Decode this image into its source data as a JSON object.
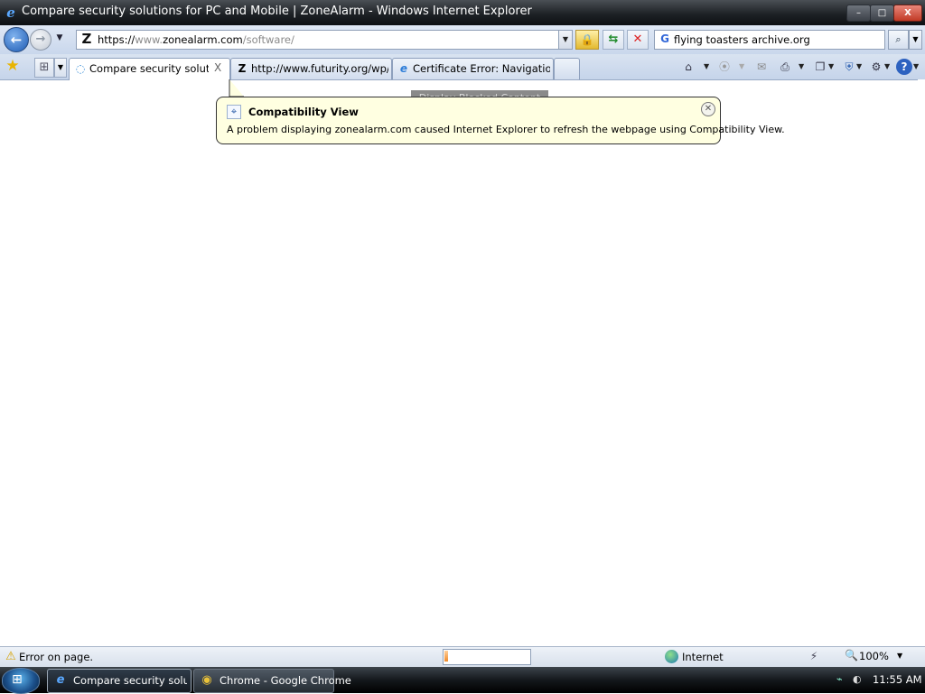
{
  "window": {
    "title": "Compare security solutions for PC and Mobile | ZoneAlarm - Windows Internet Explorer",
    "icon": "ie-icon",
    "controls": {
      "minimize": "–",
      "maximize": "□",
      "close": "X"
    }
  },
  "navigation": {
    "back_icon": "←",
    "forward_icon": "→",
    "history_dropdown": "▼",
    "address": {
      "site_icon_glyph": "Z",
      "scheme": "https://",
      "prefix": "www.",
      "domain": "zonealarm.com",
      "path": "/software/"
    },
    "address_dropdown": "▼",
    "lock_icon": "🔒",
    "refresh_icon": "⇆",
    "stop_icon": "✕",
    "search": {
      "provider_glyph": "G",
      "value": "flying toasters archive.org",
      "go_icon": "⌕",
      "dropdown": "▼"
    }
  },
  "tabs": {
    "favorites_icon": "★",
    "quick_tabs_icon": "⊞",
    "tab_list_dropdown": "▼",
    "items": [
      {
        "icon": "◌",
        "label": "Compare security solutio...",
        "close": "X",
        "active": true
      },
      {
        "icon": "Z",
        "label": "http://www.futurity.org/wp/...",
        "active": false
      },
      {
        "icon": "e",
        "label": "Certificate Error: Navigation ...",
        "active": false
      }
    ]
  },
  "command_bar": {
    "home": "⌂",
    "feeds": "⦿",
    "mail": "✉",
    "print": "⎙",
    "page": "❐",
    "safety": "⛨",
    "tools": "⚙",
    "help": "?",
    "dd": "▼"
  },
  "infobar": {
    "blocked_label": "Display Blocked Content"
  },
  "compat_popup": {
    "icon": "⌖",
    "title": "Compatibility View",
    "message": "A problem displaying zonealarm.com caused Internet Explorer to refresh the webpage using Compatibility View.",
    "close": "✕"
  },
  "status": {
    "warning_icon": "⚠",
    "text": "Error on page.",
    "progress": 0.04,
    "zone": "Internet",
    "protected_icon": "⚡",
    "zoom_icon": "🔍",
    "zoom": "100%",
    "zoom_dropdown": "▼"
  },
  "taskbar": {
    "start_glyph": "⊞",
    "items": [
      {
        "icon": "e",
        "label": "Compare security solu...",
        "active": true
      },
      {
        "icon": "◉",
        "label": "Chrome - Google Chrome",
        "active": false
      }
    ],
    "tray_network": "⌁",
    "tray_volume": "◐",
    "clock": "11:55 AM"
  },
  "colors": {
    "accent": "#1e5bb3",
    "popup_bg": "#ffffe1",
    "progress": "#f08a2a"
  }
}
